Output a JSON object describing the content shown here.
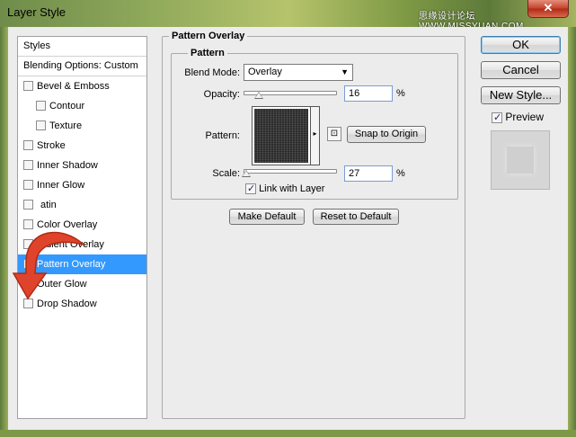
{
  "window": {
    "title": "Layer Style",
    "watermark": "思缘设计论坛 WWW.MISSYUAN.COM",
    "close_glyph": "✕"
  },
  "style_list": {
    "header": "Styles",
    "blending_options": "Blending Options: Custom",
    "items": [
      {
        "label": "Bevel & Emboss",
        "checked": false,
        "sub": false
      },
      {
        "label": "Contour",
        "checked": false,
        "sub": true
      },
      {
        "label": "Texture",
        "checked": false,
        "sub": true
      },
      {
        "label": "Stroke",
        "checked": false,
        "sub": false
      },
      {
        "label": "Inner Shadow",
        "checked": false,
        "sub": false
      },
      {
        "label": "Inner Glow",
        "checked": false,
        "sub": false
      },
      {
        "label": "Satin",
        "checked": false,
        "sub": false
      },
      {
        "label": "Color Overlay",
        "checked": false,
        "sub": false
      },
      {
        "label": "Gradient Overlay",
        "checked": false,
        "sub": false
      },
      {
        "label": "Pattern Overlay",
        "checked": true,
        "sub": false,
        "selected": true
      },
      {
        "label": "Outer Glow",
        "checked": false,
        "sub": false
      },
      {
        "label": "Drop Shadow",
        "checked": false,
        "sub": false
      }
    ],
    "visible_labels": {
      "satin": "atin",
      "color_overlay": "Color Overlay",
      "gradient_overlay": "adient Overlay"
    }
  },
  "panel": {
    "group_title": "Pattern Overlay",
    "sub_group_title": "Pattern",
    "blend_mode_label": "Blend Mode:",
    "blend_mode_value": "Overlay",
    "opacity_label": "Opacity:",
    "opacity_value": "16",
    "opacity_percent": 16,
    "pattern_label": "Pattern:",
    "snap_button": "Snap to Origin",
    "scale_label": "Scale:",
    "scale_value": "27",
    "scale_percent": 27,
    "percent_sign": "%",
    "link_with_layer": "Link with Layer",
    "link_checked": true,
    "make_default": "Make Default",
    "reset_default": "Reset to Default"
  },
  "side_buttons": {
    "ok": "OK",
    "cancel": "Cancel",
    "new_style": "New Style...",
    "preview_label": "Preview",
    "preview_checked": true
  },
  "colors": {
    "selection": "#3399ff",
    "annotation_arrow": "#e0432b",
    "dialog_bg": "#ececec"
  },
  "glyphs": {
    "check": "✓",
    "dropdown_arrow": "▼",
    "pattern_dropdown": "▸",
    "pattern_menu": "⊡"
  }
}
